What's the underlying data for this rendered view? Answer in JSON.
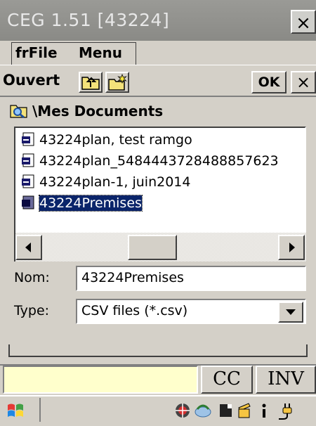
{
  "window": {
    "title": "CEG 1.51 [43224]"
  },
  "menu": {
    "items": [
      "frFile",
      "Menu"
    ]
  },
  "toolbar": {
    "label": "Ouvert",
    "ok_label": "OK",
    "close_glyph": "×"
  },
  "title_close_glyph": "×",
  "path": "\\Mes Documents",
  "files": [
    {
      "name": "43224plan, test ramgo",
      "selected": false
    },
    {
      "name": "43224plan_5484443728488857623",
      "selected": false
    },
    {
      "name": "43224plan-1, juin2014",
      "selected": false
    },
    {
      "name": "43224Premises",
      "selected": true
    }
  ],
  "form": {
    "nom_label": "Nom:",
    "nom_value": "43224Premises",
    "type_label": "Type:",
    "type_value": "CSV files (*.csv)"
  },
  "buttons": {
    "cc": "CC",
    "inv": "INV"
  },
  "taskbar_icons": [
    "windows-start-icon",
    "network-icon",
    "sync-icon",
    "card-icon",
    "battery-icon",
    "info-icon",
    "power-icon"
  ],
  "colors": {
    "selection": "#0a246a",
    "input_bg": "#ffffcc",
    "face": "#d4d0c8"
  }
}
